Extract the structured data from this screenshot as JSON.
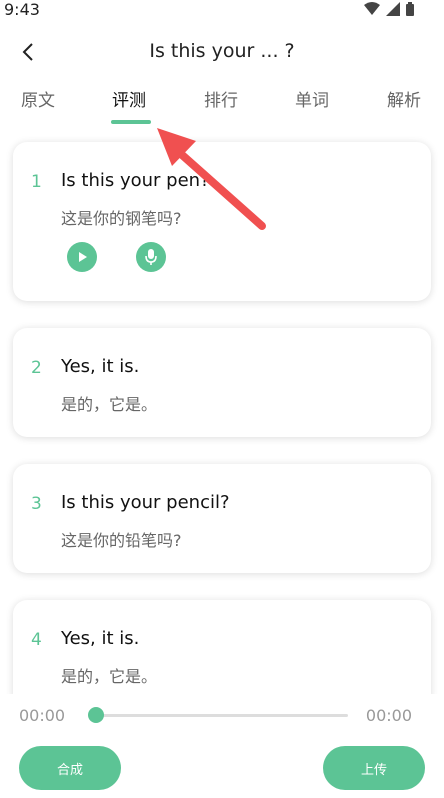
{
  "status": {
    "time": "9:43"
  },
  "header": {
    "title": "Is this your ... ?"
  },
  "tabs": [
    {
      "label": "原文"
    },
    {
      "label": "评测"
    },
    {
      "label": "排行"
    },
    {
      "label": "单词"
    },
    {
      "label": "解析"
    }
  ],
  "active_tab": 1,
  "sentences": [
    {
      "num": "1",
      "en": "Is this your pen?",
      "zh": "这是你的钢笔吗?"
    },
    {
      "num": "2",
      "en": "Yes, it is.",
      "zh": "是的，它是。"
    },
    {
      "num": "3",
      "en": "Is this your pencil?",
      "zh": "这是你的铅笔吗?"
    },
    {
      "num": "4",
      "en": "Yes, it is.",
      "zh": "是的，它是。"
    }
  ],
  "player": {
    "current_time": "00:00",
    "total_time": "00:00",
    "progress": 0,
    "left_button": "合成",
    "right_button": "上传"
  },
  "colors": {
    "accent": "#5cc495",
    "annotation": "#f05050"
  }
}
